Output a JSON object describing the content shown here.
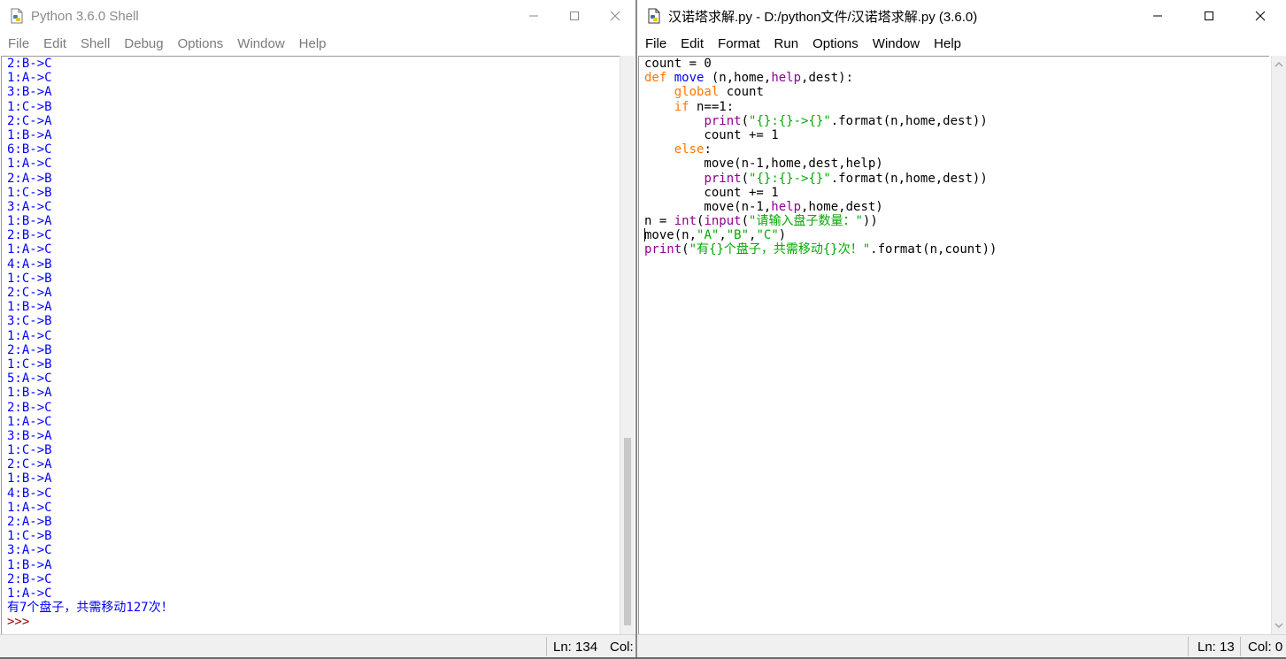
{
  "shell": {
    "title": "Python 3.6.0 Shell",
    "menu": [
      "File",
      "Edit",
      "Shell",
      "Debug",
      "Options",
      "Window",
      "Help"
    ],
    "output_lines": [
      "2:B->C",
      "1:A->C",
      "3:B->A",
      "1:C->B",
      "2:C->A",
      "1:B->A",
      "6:B->C",
      "1:A->C",
      "2:A->B",
      "1:C->B",
      "3:A->C",
      "1:B->A",
      "2:B->C",
      "1:A->C",
      "4:A->B",
      "1:C->B",
      "2:C->A",
      "1:B->A",
      "3:C->B",
      "1:A->C",
      "2:A->B",
      "1:C->B",
      "5:A->C",
      "1:B->A",
      "2:B->C",
      "1:A->C",
      "3:B->A",
      "1:C->B",
      "2:C->A",
      "1:B->A",
      "4:B->C",
      "1:A->C",
      "2:A->B",
      "1:C->B",
      "3:A->C",
      "1:B->A",
      "2:B->C",
      "1:A->C"
    ],
    "result_line": "有7个盘子，共需移动127次！",
    "prompt": ">>>",
    "status_ln": "Ln: 134",
    "status_col": "Col:"
  },
  "editor": {
    "title": "汉诺塔求解.py - D:/python文件/汉诺塔求解.py (3.6.0)",
    "menu": [
      "File",
      "Edit",
      "Format",
      "Run",
      "Options",
      "Window",
      "Help"
    ],
    "code": {
      "l1": "count = 0",
      "l2_kw": "def",
      "l2_fn": "move",
      "l2_a": " (n,home,",
      "l2_bi": "help",
      "l2_b": ",dest):",
      "l3_ind": "    ",
      "l3_kw": "global",
      "l3_rest": " count",
      "l4_ind": "    ",
      "l4_kw": "if",
      "l4_rest": " n==1:",
      "l5_ind": "        ",
      "l5_bi": "print",
      "l5_a": "(",
      "l5_str": "\"{}:{}->{}\"",
      "l5_b": ".format(n,home,dest))",
      "l6": "        count += 1",
      "l7_ind": "    ",
      "l7_kw": "else",
      "l7_rest": ":",
      "l8": "        move(n-1,home,dest,help)",
      "l9_ind": "        ",
      "l9_bi": "print",
      "l9_a": "(",
      "l9_str": "\"{}:{}->{}\"",
      "l9_b": ".format(n,home,dest))",
      "l10": "        count += 1",
      "l11_a": "        move(n-1,",
      "l11_bi": "help",
      "l11_b": ",home,dest)",
      "l12_a": "n = ",
      "l12_bi1": "int",
      "l12_b": "(",
      "l12_bi2": "input",
      "l12_c": "(",
      "l12_str": "\"请输入盘子数量：\"",
      "l12_d": "))",
      "l13_a": "move(n,",
      "l13_s1": "\"A\"",
      "l13_c1": ",",
      "l13_s2": "\"B\"",
      "l13_c2": ",",
      "l13_s3": "\"C\"",
      "l13_b": ")",
      "l14_bi": "print",
      "l14_a": "(",
      "l14_str": "\"有{}个盘子，共需移动{}次！\"",
      "l14_b": ".format(n,count))"
    },
    "status_ln": "Ln: 13",
    "status_col": "Col: 0"
  },
  "colors": {
    "keyword": "#ff7700",
    "builtin": "#900090",
    "definition": "#0000ff",
    "string": "#00aa00",
    "shell_output": "#0000ff",
    "prompt": "#990000"
  },
  "icons": [
    "python-file-icon",
    "minimize-icon",
    "maximize-icon",
    "close-icon",
    "scroll-up-arrow-icon",
    "scroll-down-arrow-icon"
  ]
}
